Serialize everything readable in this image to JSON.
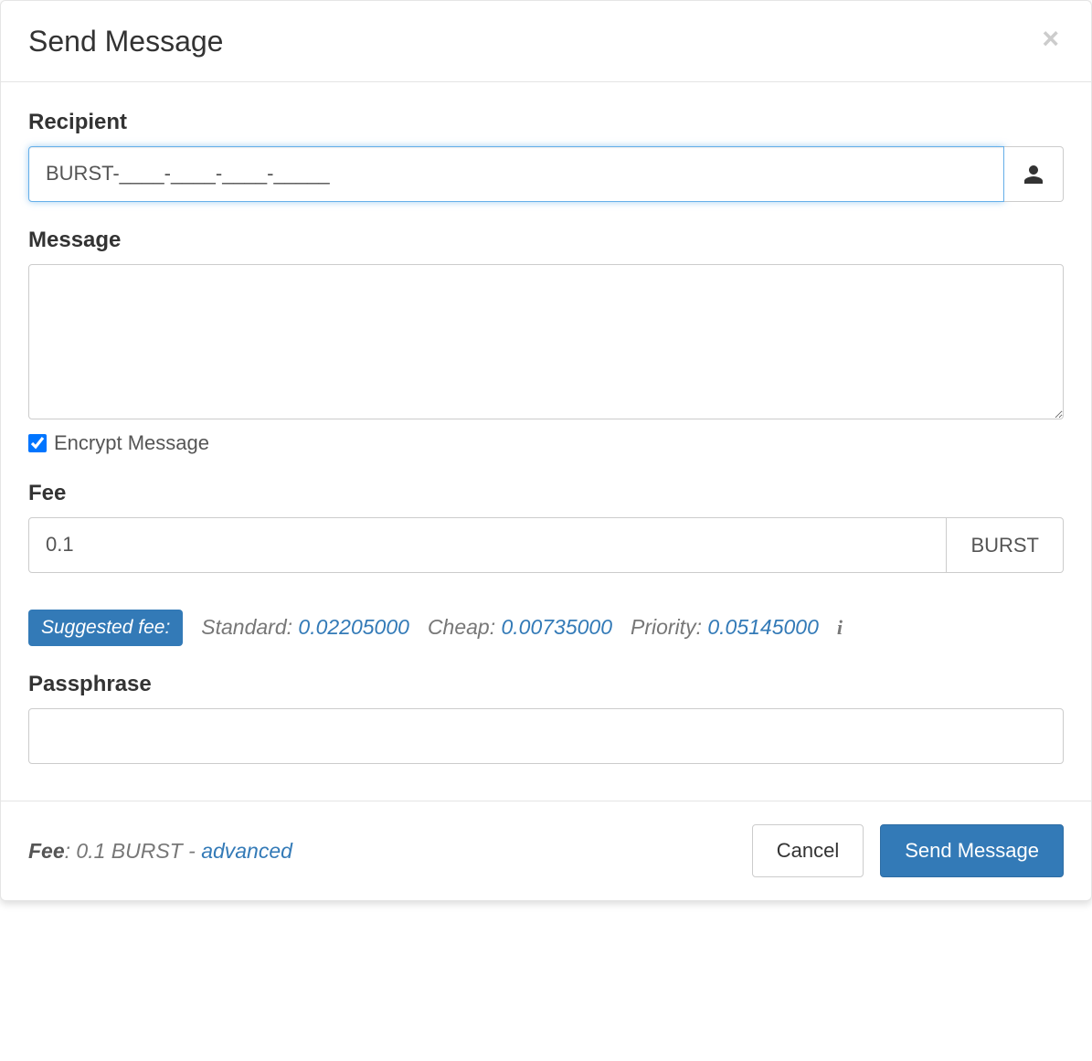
{
  "modal": {
    "title": "Send Message",
    "close_glyph": "×"
  },
  "form": {
    "recipient": {
      "label": "Recipient",
      "value": "BURST-____-____-____-_____"
    },
    "message": {
      "label": "Message",
      "value": ""
    },
    "encrypt": {
      "label": "Encrypt Message",
      "checked": true
    },
    "fee": {
      "label": "Fee",
      "value": "0.1",
      "unit": "BURST"
    },
    "suggested": {
      "badge_label": "Suggested fee:",
      "standard_label": "Standard: ",
      "standard_value": "0.02205000",
      "cheap_label": "Cheap: ",
      "cheap_value": "0.00735000",
      "priority_label": "Priority: ",
      "priority_value": "0.05145000"
    },
    "passphrase": {
      "label": "Passphrase",
      "value": ""
    }
  },
  "footer": {
    "fee_label": "Fee",
    "fee_text": ": 0.1 BURST - ",
    "advanced_label": "advanced",
    "cancel_label": "Cancel",
    "submit_label": "Send Message"
  }
}
